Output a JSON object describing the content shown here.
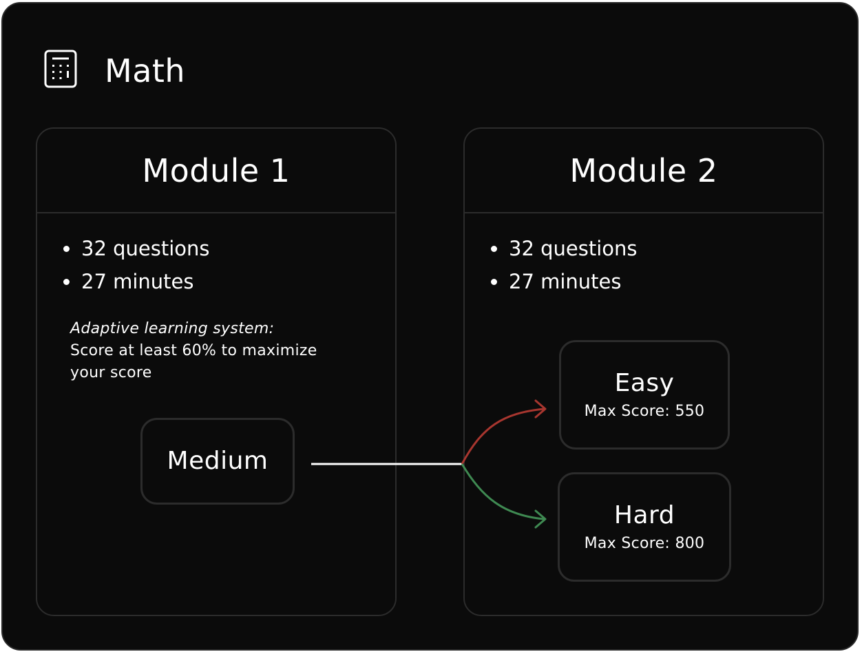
{
  "page": {
    "title": "Math",
    "icon": "calculator-icon"
  },
  "modules": [
    {
      "title": "Module 1",
      "items": [
        "32 questions",
        "27 minutes"
      ],
      "note": {
        "heading": "Adaptive learning system:",
        "body": "Score at least 60% to maximize your score"
      },
      "levels": [
        {
          "name": "Medium"
        }
      ]
    },
    {
      "title": "Module 2",
      "items": [
        "32 questions",
        "27 minutes"
      ],
      "levels": [
        {
          "name": "Easy",
          "score": "Max Score: 550"
        },
        {
          "name": "Hard",
          "score": "Max Score: 800"
        }
      ]
    }
  ],
  "colors": {
    "background": "#0b0b0b",
    "border": "#2c2c2c",
    "text": "#ffffff",
    "connector": "#ffffff",
    "easy_arrow": "#a8362f",
    "hard_arrow": "#3f8a52"
  }
}
